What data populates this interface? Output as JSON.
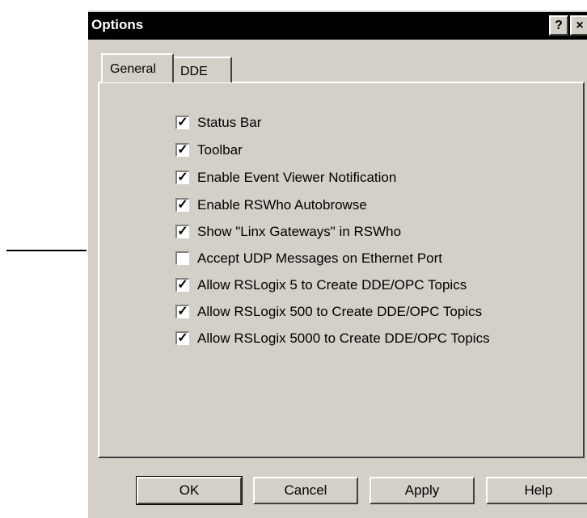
{
  "window": {
    "title": "Options",
    "help_button": "?",
    "close_button": "×"
  },
  "tabs": [
    {
      "label": "General",
      "selected": true
    },
    {
      "label": "DDE",
      "selected": false
    }
  ],
  "options": [
    {
      "label": "Status Bar",
      "checked": true
    },
    {
      "label": "Toolbar",
      "checked": true
    },
    {
      "label": "Enable Event Viewer Notification",
      "checked": true
    },
    {
      "label": "Enable RSWho Autobrowse",
      "checked": true
    },
    {
      "label": "Show \"Linx Gateways\" in RSWho",
      "checked": true
    },
    {
      "label": "Accept UDP Messages on Ethernet Port",
      "checked": false
    },
    {
      "label": "Allow RSLogix 5 to Create DDE/OPC Topics",
      "checked": true
    },
    {
      "label": "Allow RSLogix 500 to Create DDE/OPC Topics",
      "checked": true
    },
    {
      "label": "Allow RSLogix 5000 to Create DDE/OPC Topics",
      "checked": true
    }
  ],
  "buttons": {
    "ok": "OK",
    "cancel": "Cancel",
    "apply": "Apply",
    "help": "Help"
  },
  "checkmark_glyph": "✓"
}
